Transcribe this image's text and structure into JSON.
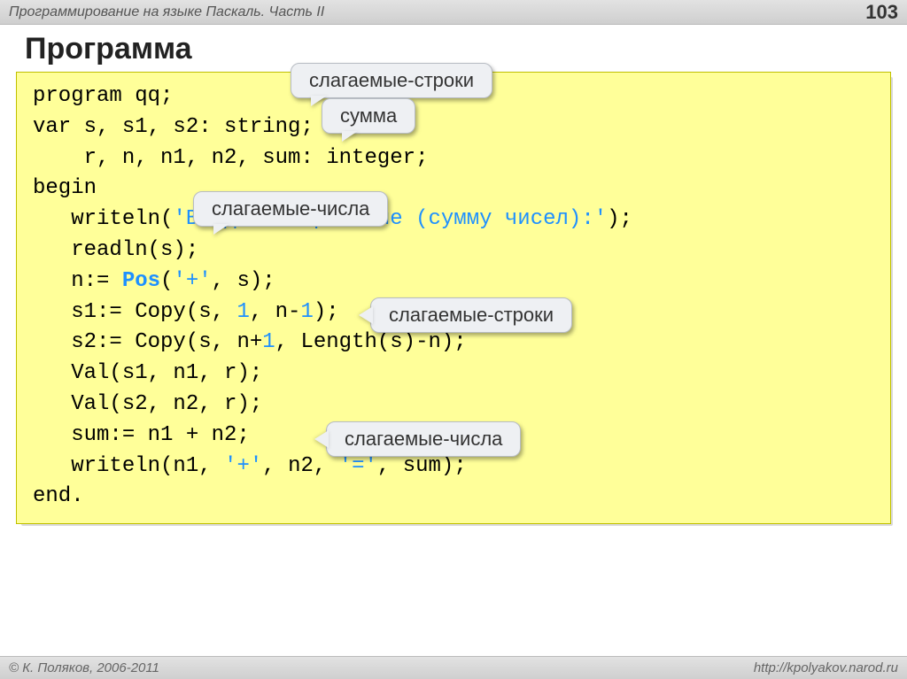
{
  "header": {
    "breadcrumb": "Программирование на языке Паскаль. Часть II",
    "page_number": "103"
  },
  "title": "Программа",
  "callouts": {
    "c1": "слагаемые-строки",
    "c2": "сумма",
    "c3": "слагаемые-числа",
    "c4": "слагаемые-строки",
    "c5": "слагаемые-числа"
  },
  "code": {
    "l1a": "program qq;",
    "l2a": "var s, s1, s2: string;",
    "l3a": "    r, n, n1, n2, sum: integer;",
    "l4a": "begin",
    "l5a": "   writeln(",
    "l5b": "'Введите выражение (сумму чисел):'",
    "l5c": ");",
    "l6a": "   readln(s);",
    "l7a": "   n:= ",
    "l7b": "Pos",
    "l7c": "(",
    "l7d": "'+'",
    "l7e": ", s);",
    "l8a": "   s1:= Copy(s, ",
    "l8b": "1",
    "l8c": ", n-",
    "l8d": "1",
    "l8e": ");",
    "l9a": "   s2:= Copy(s, n+",
    "l9b": "1",
    "l9c": ", Length(s)-n);",
    "l10a": "   Val(s1, n1, r);",
    "l11a": "   Val(s2, n2, r);",
    "l12a": "   sum:= n1 + n2;",
    "l13a": "   writeln(n1, ",
    "l13b": "'+'",
    "l13c": ", n2, ",
    "l13d": "'='",
    "l13e": ", sum);",
    "l14a": "end."
  },
  "footer": {
    "copyright": "© К. Поляков, 2006-2011",
    "url": "http://kpolyakov.narod.ru"
  }
}
